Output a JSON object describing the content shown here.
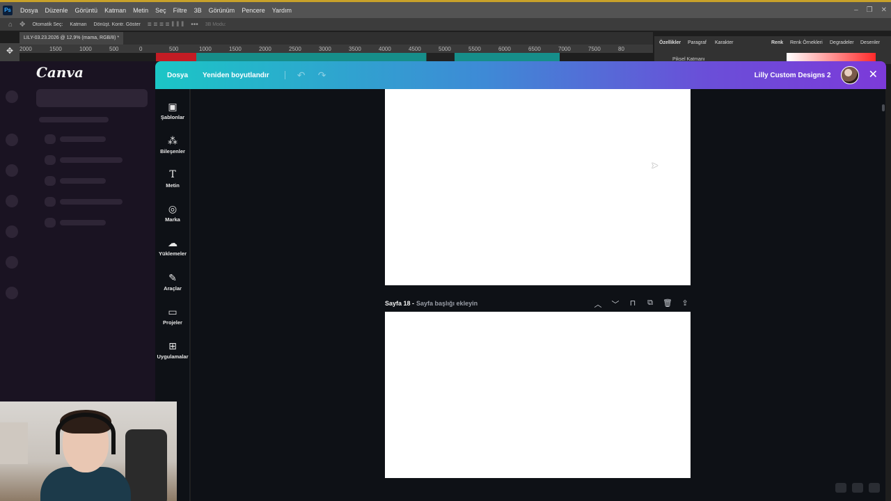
{
  "photoshop": {
    "menu": [
      "Dosya",
      "Düzenle",
      "Görüntü",
      "Katman",
      "Metin",
      "Seç",
      "Filtre",
      "3B",
      "Görünüm",
      "Pencere",
      "Yardım"
    ],
    "options": {
      "auto_select": "Otomatik Seç:",
      "layer": "Katman",
      "transform": "Dönüşt. Kontr. Göster",
      "mode_3d": "3B Modu:"
    },
    "doc_tab": "LILY-03.23.2026 @ 12,9% (mama, RGB/8) *",
    "ruler": [
      "2000",
      "1500",
      "1000",
      "500",
      "0",
      "500",
      "1000",
      "1500",
      "2000",
      "2500",
      "3000",
      "3500",
      "4000",
      "4500",
      "5000",
      "5500",
      "6000",
      "6500",
      "7000",
      "7500",
      "80"
    ],
    "panel_tabs": [
      "Özellikler",
      "Paragraf",
      "Karakter",
      "Renk",
      "Renk Örnekleri",
      "Degradeler",
      "Desenler"
    ],
    "pixel_layer": "Piksel Katmanı"
  },
  "canva": {
    "logo": "Canva",
    "topbar": {
      "file": "Dosya",
      "resize": "Yeniden boyutlandır",
      "design_name": "Lilly Custom Designs 2"
    },
    "sidebar": [
      {
        "label": "Şablonlar",
        "icon": "templates-icon"
      },
      {
        "label": "Bileşenler",
        "icon": "elements-icon"
      },
      {
        "label": "Metin",
        "icon": "text-icon"
      },
      {
        "label": "Marka",
        "icon": "brand-icon"
      },
      {
        "label": "Yüklemeler",
        "icon": "uploads-icon"
      },
      {
        "label": "Araçlar",
        "icon": "tools-icon"
      },
      {
        "label": "Projeler",
        "icon": "projects-icon"
      },
      {
        "label": "Uygulamalar",
        "icon": "apps-icon"
      }
    ],
    "page": {
      "title": "Sayfa 18 -",
      "subtitle": "Sayfa başlığı ekleyin"
    }
  }
}
